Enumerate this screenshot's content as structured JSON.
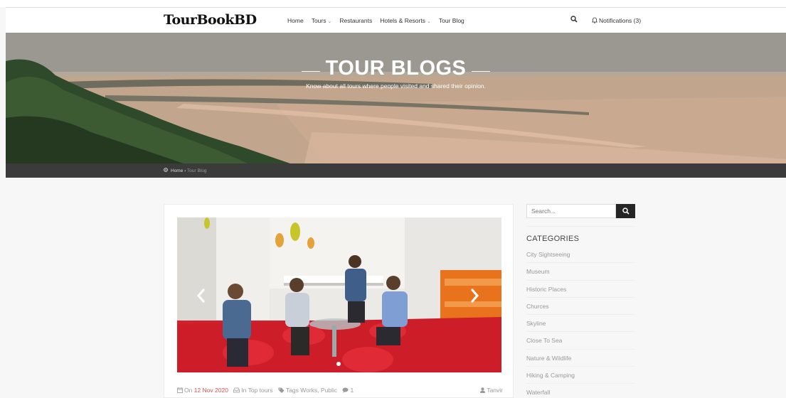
{
  "nav": {
    "logo": "TourBookBD",
    "items": [
      {
        "label": "Home"
      },
      {
        "label": "Tours",
        "caret": "⌄"
      },
      {
        "label": "Restaurants"
      },
      {
        "label": "Hotels & Resorts",
        "caret": "⌄"
      },
      {
        "label": "Tour Blog"
      }
    ],
    "notifications": "Notifications (3)",
    "icons": {
      "search": "search-icon",
      "bell": "bell-icon"
    }
  },
  "hero": {
    "title": "TOUR BLOGS",
    "subtitle": "Know about all tours where people visited and shared their opinion."
  },
  "breadcrumb": {
    "home": "Home",
    "separator": "›",
    "current": "Tour Blog"
  },
  "post": {
    "meta": {
      "date_prefix": "On",
      "date": "12 Nov 2020",
      "category": "In Top tours",
      "tags": "Tags Works, Public",
      "comments": "1",
      "author": "Tanvir"
    }
  },
  "sidebar": {
    "search_placeholder": "Search...",
    "categories_title": "CATEGORIES",
    "categories": [
      "City Sightseeing",
      "Museum",
      "Historic Places",
      "Churces",
      "Skyline",
      "Close To Sea",
      "Nature & Wildlife",
      "Hiking & Camping",
      "Waterfall"
    ]
  },
  "colors": {
    "accent_date": "#d9534f",
    "breadcrumb_bg": "#3b3b3b",
    "search_button": "#262626"
  }
}
